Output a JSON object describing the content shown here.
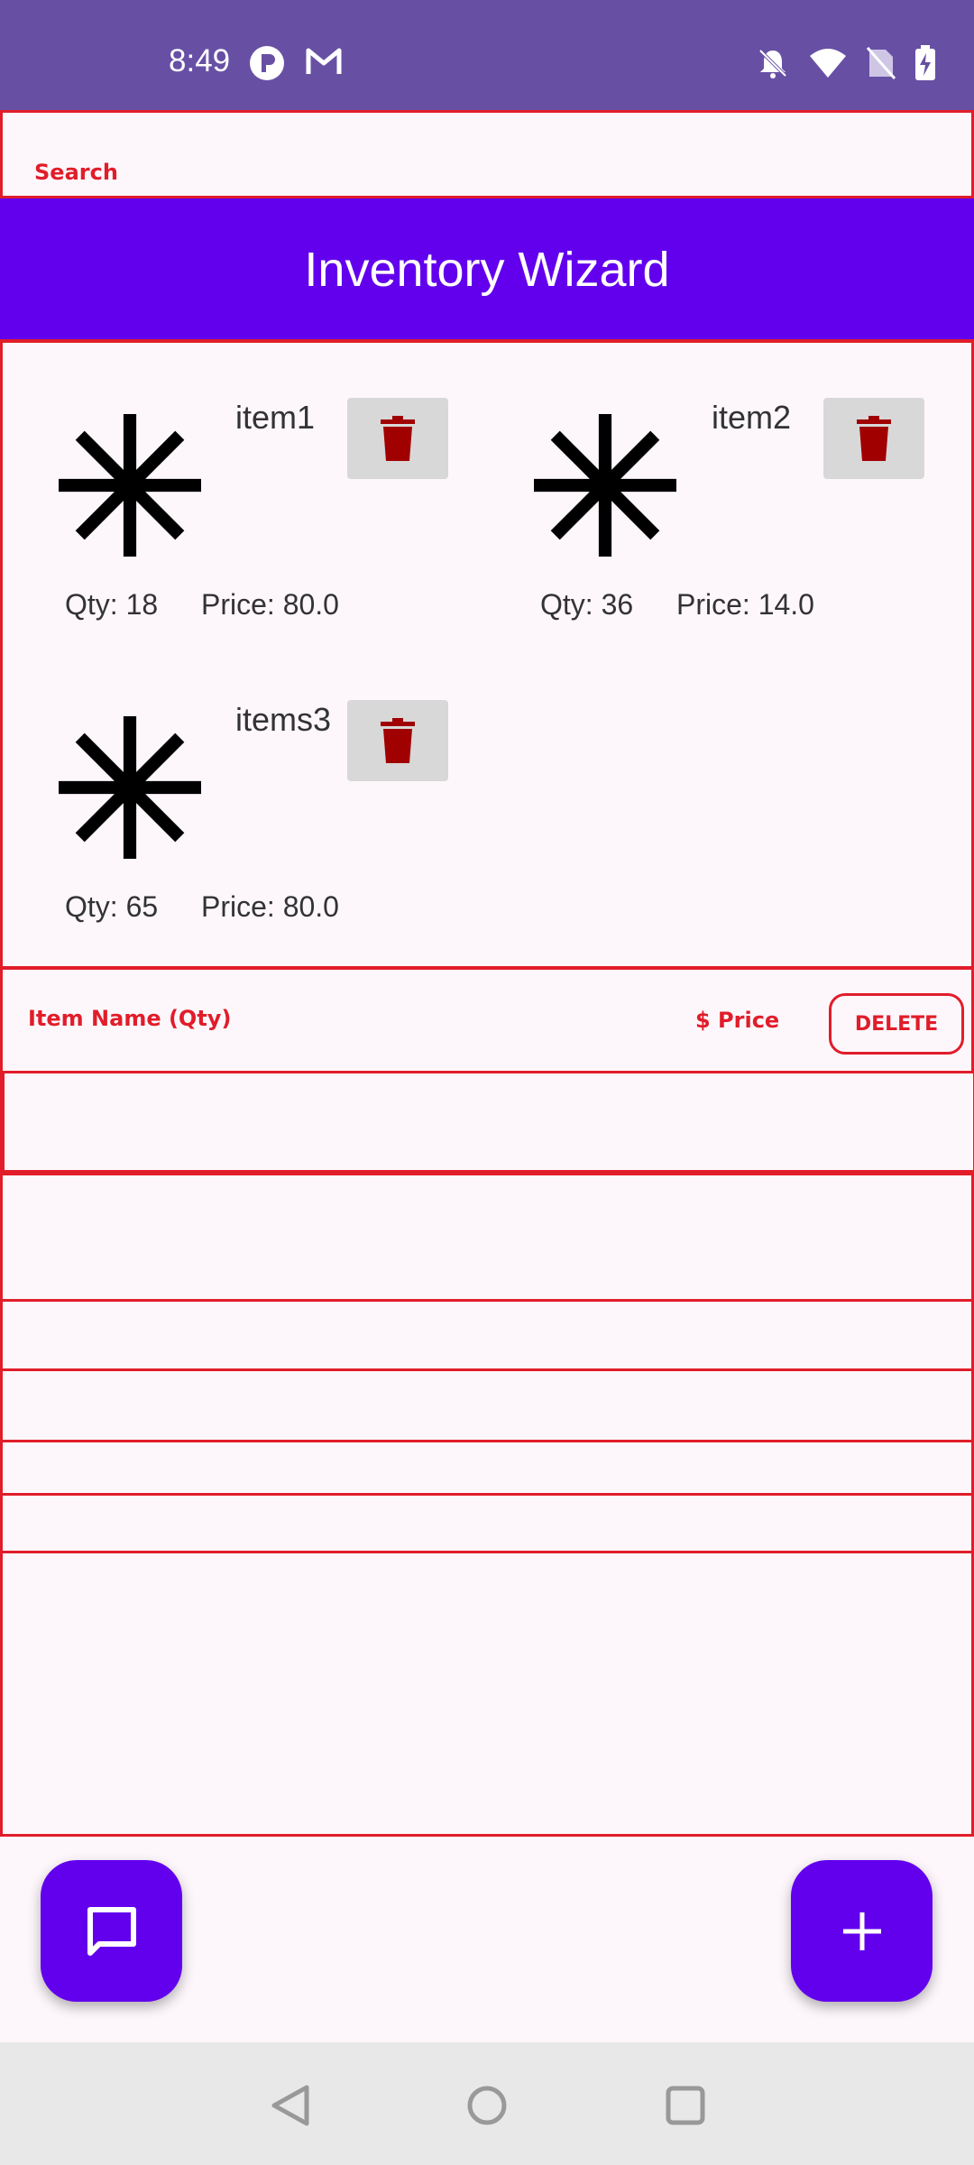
{
  "status_bar": {
    "time": "8:49",
    "icons_left": [
      "p-app-icon",
      "gmail-icon"
    ],
    "icons_right": [
      "bell-off-icon",
      "wifi-icon",
      "no-sim-icon",
      "battery-charging-icon"
    ]
  },
  "search": {
    "label": "Search"
  },
  "header": {
    "title": "Inventory Wizard"
  },
  "items": [
    {
      "name": "item1",
      "qty": "Qty: 18",
      "price": "Price: 80.0"
    },
    {
      "name": "item2",
      "qty": "Qty: 36",
      "price": "Price: 14.0"
    },
    {
      "name": "items3",
      "qty": "Qty: 65",
      "price": "Price: 80.0"
    }
  ],
  "table": {
    "col_name": "Item Name (Qty)",
    "col_price": "$ Price",
    "col_delete": "DELETE"
  },
  "colors": {
    "status_bar": "#6750a4",
    "header": "#6200ee",
    "accent_red": "#e11d2a",
    "trash": "#a00000",
    "fab": "#6200ee"
  },
  "fabs": {
    "left_icon": "chat-icon",
    "right_icon": "plus-icon"
  },
  "nav": [
    "back-icon",
    "home-icon",
    "recents-icon"
  ]
}
